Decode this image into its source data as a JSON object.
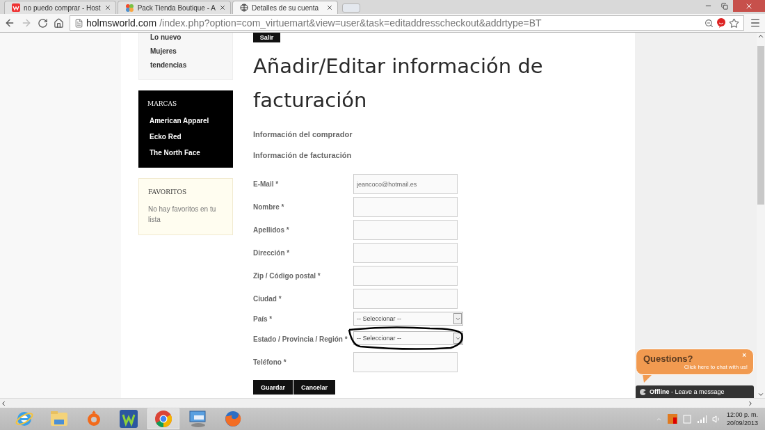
{
  "browser": {
    "tabs": [
      {
        "title": "no puedo comprar - Host",
        "kind": "w",
        "selected": false
      },
      {
        "title": "Pack Tienda Boutique - A",
        "kind": "puzzle",
        "selected": false
      },
      {
        "title": "Detalles de su cuenta",
        "kind": "globe",
        "selected": true
      }
    ],
    "url_host": "holmsworld.com",
    "url_path": "/index.php?option=com_virtuemart&view=user&task=editaddresscheckout&addrtype=BT"
  },
  "sidebar": {
    "menu_items": [
      "Lo nuevo",
      "Mujeres",
      "tendencias"
    ],
    "brands": {
      "title": "MARCAS",
      "items": [
        "American Apparel",
        "Ecko Red",
        "The North Face"
      ]
    },
    "favorites": {
      "title": "FAVORITOS",
      "text": "No hay favoritos en tu lista"
    }
  },
  "page": {
    "logout_button": "Salir",
    "title": "Añadir/Editar información de facturación",
    "sections": [
      "Información del comprador",
      "Información de facturación"
    ],
    "fields": [
      {
        "label": "E-Mail *",
        "kind": "text",
        "value": "jeancoco@hotmail.es"
      },
      {
        "label": "Nombre *",
        "kind": "text"
      },
      {
        "label": "Apellidos *",
        "kind": "text"
      },
      {
        "label": "Dirección *",
        "kind": "text"
      },
      {
        "label": "Zip / Código postal *",
        "kind": "text"
      },
      {
        "label": "Ciudad *",
        "kind": "text"
      },
      {
        "label": "País *",
        "kind": "select",
        "value": "-- Seleccionar --",
        "circled": false
      },
      {
        "label": "Estado / Provincia / Región *",
        "kind": "select",
        "value": "-- Seleccionar --",
        "circled": true
      },
      {
        "label": "Teléfono *",
        "kind": "text"
      }
    ],
    "buttons": [
      "Guardar",
      "Cancelar"
    ]
  },
  "chat": {
    "title": "Questions?",
    "close": "×",
    "subtitle": "Click here to chat with us!",
    "status": "**Offline** - Leave a message"
  },
  "taskbar": {
    "apps": [
      {
        "kind": "ie",
        "selected": false
      },
      {
        "kind": "folder",
        "selected": false
      },
      {
        "kind": "origin",
        "selected": false
      },
      {
        "kind": "w",
        "selected": false
      },
      {
        "kind": "chrome",
        "selected": true
      },
      {
        "kind": "monitor",
        "selected": false
      },
      {
        "kind": "firefox",
        "selected": false
      }
    ],
    "time": "12:00 p. m.",
    "date": "20/09/2013"
  }
}
